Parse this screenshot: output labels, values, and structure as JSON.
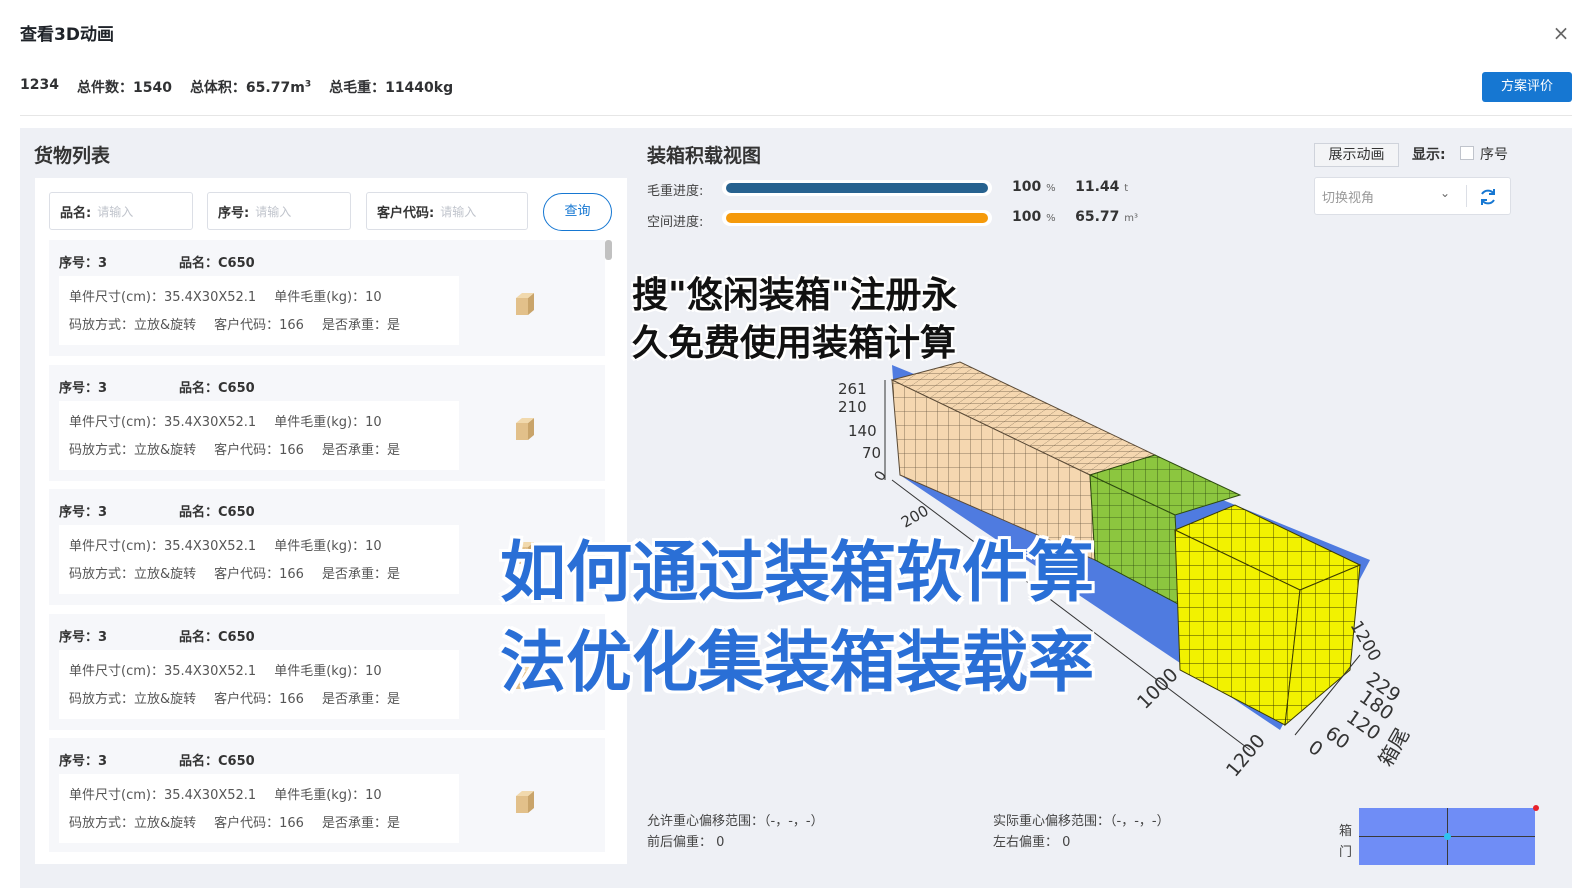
{
  "header": {
    "title": "查看3D动画",
    "close_icon": "×",
    "summary": {
      "code": "1234",
      "total_pieces": "总件数：1540",
      "total_volume": "总体积：65.77m",
      "volume_unit_sup": "3",
      "total_weight": "总毛重：11440kg"
    },
    "evaluate_button": "方案评价"
  },
  "left": {
    "title": "货物列表",
    "filters": {
      "name_label": "品名:",
      "name_placeholder": "请输入",
      "seq_label": "序号:",
      "seq_placeholder": "请输入",
      "customer_label": "客户代码:",
      "customer_placeholder": "请输入",
      "query_button": "查询"
    },
    "items": [
      {
        "seq": "序号：3",
        "name": "品名：C650",
        "size": "单件尺寸(cm)：35.4X30X52.1",
        "weight": "单件毛重(kg)：10",
        "stack": "码放方式：立放&旋转",
        "customer": "客户代码：166",
        "bearing": "是否承重：是"
      },
      {
        "seq": "序号：3",
        "name": "品名：C650",
        "size": "单件尺寸(cm)：35.4X30X52.1",
        "weight": "单件毛重(kg)：10",
        "stack": "码放方式：立放&旋转",
        "customer": "客户代码：166",
        "bearing": "是否承重：是"
      },
      {
        "seq": "序号：3",
        "name": "品名：C650",
        "size": "单件尺寸(cm)：35.4X30X52.1",
        "weight": "单件毛重(kg)：10",
        "stack": "码放方式：立放&旋转",
        "customer": "客户代码：166",
        "bearing": "是否承重：是"
      },
      {
        "seq": "序号：3",
        "name": "品名：C650",
        "size": "单件尺寸(cm)：35.4X30X52.1",
        "weight": "单件毛重(kg)：10",
        "stack": "码放方式：立放&旋转",
        "customer": "客户代码：166",
        "bearing": "是否承重：是"
      },
      {
        "seq": "序号：3",
        "name": "品名：C650",
        "size": "单件尺寸(cm)：35.4X30X52.1",
        "weight": "单件毛重(kg)：10",
        "stack": "码放方式：立放&旋转",
        "customer": "客户代码：166",
        "bearing": "是否承重：是"
      }
    ]
  },
  "right": {
    "title": "装箱积载视图",
    "weight_progress": {
      "label": "毛重进度:",
      "percent": 100,
      "percent_text": "100",
      "percent_unit": "%",
      "value": "11.44",
      "unit": "t",
      "color": "#27628f"
    },
    "space_progress": {
      "label": "空间进度:",
      "percent": 100,
      "percent_text": "100",
      "percent_unit": "%",
      "value": "65.77",
      "unit": "m³",
      "color": "#f59a0b"
    },
    "show_animation_button": "展示动画",
    "display_label": "显示:",
    "seq_checkbox_label": "序号",
    "view_select_value": "切换视角",
    "axis": {
      "height_ticks": [
        "261",
        "210",
        "140",
        "70",
        "0"
      ],
      "length_ticks": [
        "200",
        "1000",
        "1200"
      ],
      "right_ticks": [
        "1200",
        "229",
        "180",
        "120",
        "60",
        "0"
      ],
      "tail_label": "箱尾"
    },
    "cog": {
      "allowed_range": "允许重心偏移范围：（-，-，-）",
      "front_back": "前后偏重：  0",
      "actual_range": "实际重心偏移范围：（-，-，-）",
      "left_right": "左右偏重：  0"
    },
    "door_label_1": "箱",
    "door_label_2": "门",
    "colors": {
      "tan": "#f5d7b0",
      "green": "#8cc63f",
      "yellow": "#f2f200",
      "container": "#4f7be0"
    }
  },
  "overlay": {
    "line1": "搜\"悠闲装箱\"注册永",
    "line2": "久免费使用装箱计算",
    "line3": "如何通过装箱软件算",
    "line4": "法优化集装箱装载率"
  }
}
